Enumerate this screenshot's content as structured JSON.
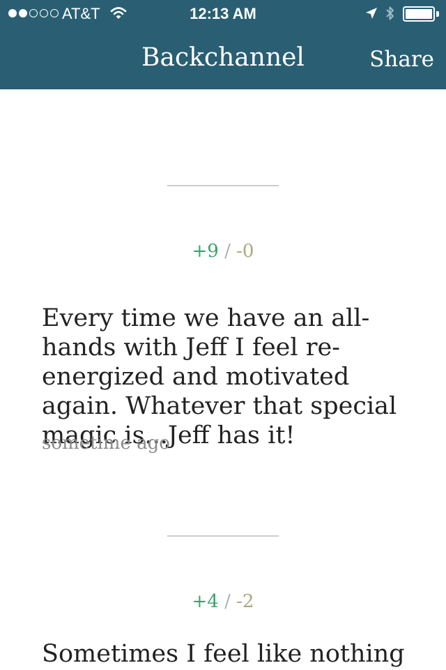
{
  "status_bar": {
    "carrier": "AT&T",
    "time": "12:13 AM",
    "signal_bars_filled": 2,
    "signal_bars_total": 5,
    "battery_level": 1.0
  },
  "nav": {
    "title": "Backchannel",
    "share_label": "Share"
  },
  "posts": [
    {
      "votes_up": "+9",
      "votes_down": "-0",
      "text": "Every time we have an all-hands with Jeff I feel re-energized and motivated again. Whatever that special magic is...Jeff has it!",
      "time": "sometime ago"
    },
    {
      "votes_up": "+4",
      "votes_down": "-2",
      "text": "Sometimes I feel like nothing",
      "time": ""
    }
  ],
  "vote_separator": "/",
  "colors": {
    "nav_background": "#2a5f73",
    "upvote": "#3aa36c",
    "downvote": "#a9a97a",
    "timestamp": "#8a8a8a"
  }
}
